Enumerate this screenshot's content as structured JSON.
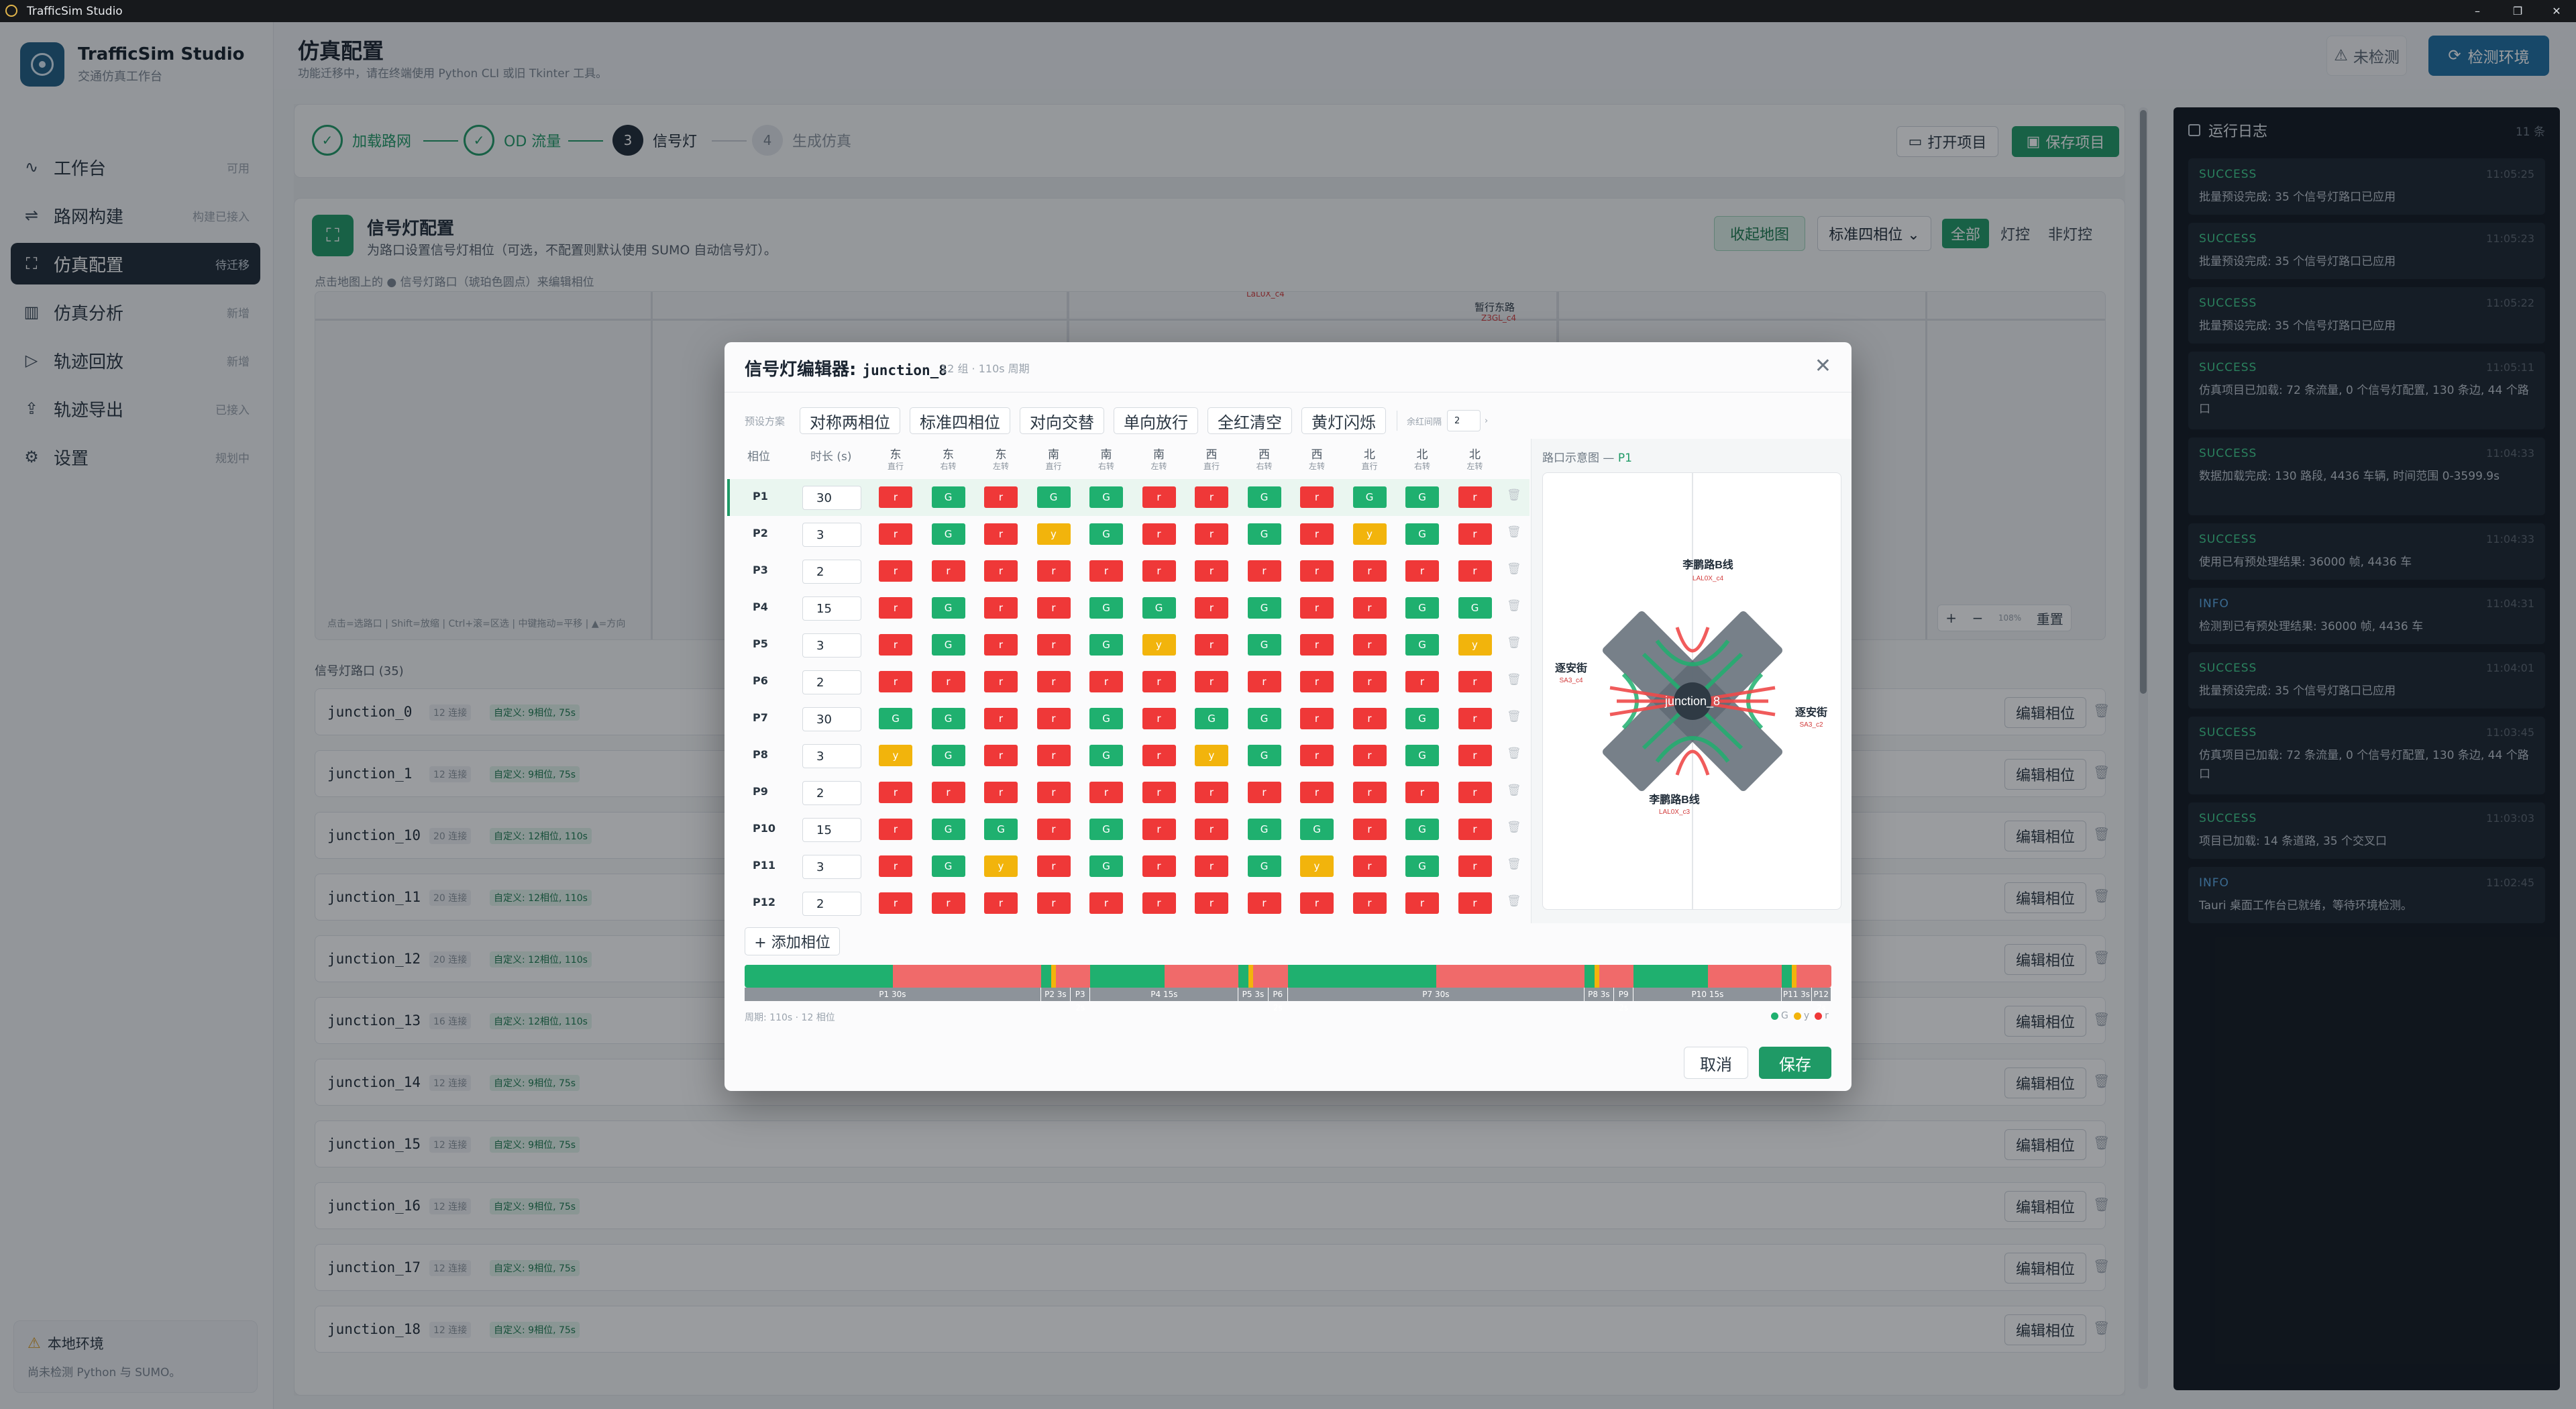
{
  "window": {
    "title": "TrafficSim Studio",
    "controls": [
      "–",
      "❐",
      "✕"
    ]
  },
  "sidebar": {
    "brand_name": "TrafficSim Studio",
    "brand_sub": "交通仿真工作台",
    "items": [
      {
        "label": "工作台",
        "badge": "可用",
        "icon": "activity-icon"
      },
      {
        "label": "路网构建",
        "badge": "构建已接入",
        "icon": "route-icon"
      },
      {
        "label": "仿真配置",
        "badge": "待迁移",
        "icon": "traffic-light-icon",
        "active": true
      },
      {
        "label": "仿真分析",
        "badge": "新增",
        "icon": "bar-chart-icon"
      },
      {
        "label": "轨迹回放",
        "badge": "新增",
        "icon": "play-icon"
      },
      {
        "label": "轨迹导出",
        "badge": "已接入",
        "icon": "upload-icon"
      },
      {
        "label": "设置",
        "badge": "规划中",
        "icon": "gear-icon"
      }
    ],
    "env_title": "本地环境",
    "env_sub": "尚未检测 Python 与 SUMO。"
  },
  "header": {
    "title": "仿真配置",
    "subtitle": "功能迁移中，请在终端使用 Python CLI 或旧 Tkinter 工具。",
    "unchecked_label": "未检测",
    "check_label": "检测环境"
  },
  "steps": {
    "items": [
      {
        "num": "✓",
        "label": "加载路网",
        "state": "done"
      },
      {
        "num": "✓",
        "label": "OD 流量",
        "state": "done"
      },
      {
        "num": "3",
        "label": "信号灯",
        "state": "cur"
      },
      {
        "num": "4",
        "label": "生成仿真",
        "state": "todo"
      }
    ],
    "open_label": "打开项目",
    "save_label": "保存项目"
  },
  "config": {
    "title": "信号灯配置",
    "subtitle": "为路口设置信号灯相位（可选，不配置则默认使用 SUMO 自动信号灯）。",
    "hint": "点击地图上的 ● 信号灯路口（琥珀色圆点）来编辑相位",
    "collapse_label": "收起地图",
    "preset_label": "标准四相位 ⌄",
    "seg_all": "全部",
    "seg_signal": "灯控",
    "seg_nonsignal": "非灯控",
    "map_labels": [
      "LaL0X_c4",
      "暂行东路",
      "Z3GL_c4"
    ],
    "map_tools": "点击=选路口 | Shift=放缩 | Ctrl+滚=区选 | 中键拖动=平移 | ▲=方向",
    "zoom": {
      "plus": "+",
      "minus": "−",
      "level": "108%",
      "reset": "重置"
    },
    "list_title": "信号灯路口 (35)",
    "edit_label": "编辑相位",
    "junctions": [
      {
        "name": "junction_0",
        "conns": "12 连接",
        "tag": "自定义: 9相位, 75s"
      },
      {
        "name": "junction_1",
        "conns": "12 连接",
        "tag": "自定义: 9相位, 75s"
      },
      {
        "name": "junction_10",
        "conns": "20 连接",
        "tag": "自定义: 12相位, 110s"
      },
      {
        "name": "junction_11",
        "conns": "20 连接",
        "tag": "自定义: 12相位, 110s"
      },
      {
        "name": "junction_12",
        "conns": "20 连接",
        "tag": "自定义: 12相位, 110s"
      },
      {
        "name": "junction_13",
        "conns": "16 连接",
        "tag": "自定义: 12相位, 110s"
      },
      {
        "name": "junction_14",
        "conns": "12 连接",
        "tag": "自定义: 9相位, 75s"
      },
      {
        "name": "junction_15",
        "conns": "12 连接",
        "tag": "自定义: 9相位, 75s"
      },
      {
        "name": "junction_16",
        "conns": "12 连接",
        "tag": "自定义: 9相位, 75s"
      },
      {
        "name": "junction_17",
        "conns": "12 连接",
        "tag": "自定义: 9相位, 75s"
      },
      {
        "name": "junction_18",
        "conns": "12 连接",
        "tag": "自定义: 9相位, 75s"
      }
    ]
  },
  "log": {
    "title": "运行日志",
    "count": "11 条",
    "entries": [
      {
        "type": "SUCCESS",
        "time": "11:05:25",
        "msg": "批量预设完成: 35 个信号灯路口已应用"
      },
      {
        "type": "SUCCESS",
        "time": "11:05:23",
        "msg": "批量预设完成: 35 个信号灯路口已应用"
      },
      {
        "type": "SUCCESS",
        "time": "11:05:22",
        "msg": "批量预设完成: 35 个信号灯路口已应用"
      },
      {
        "type": "SUCCESS",
        "time": "11:05:11",
        "msg": "仿真项目已加载: 72 条流量, 0 个信号灯配置, 130 条边, 44 个路口"
      },
      {
        "type": "SUCCESS",
        "time": "11:04:33",
        "msg": "数据加载完成: 130 路段, 4436 车辆, 时间范围 0-3599.9s"
      },
      {
        "type": "SUCCESS",
        "time": "11:04:33",
        "msg": "使用已有预处理结果: 36000 帧, 4436 车"
      },
      {
        "type": "INFO",
        "time": "11:04:31",
        "msg": "检测到已有预处理结果: 36000 帧, 4436 车"
      },
      {
        "type": "SUCCESS",
        "time": "11:04:01",
        "msg": "批量预设完成: 35 个信号灯路口已应用"
      },
      {
        "type": "SUCCESS",
        "time": "11:03:45",
        "msg": "仿真项目已加载: 72 条流量, 0 个信号灯配置, 130 条边, 44 个路口"
      },
      {
        "type": "SUCCESS",
        "time": "11:03:03",
        "msg": "项目已加载: 14 条道路, 35 个交叉口"
      },
      {
        "type": "INFO",
        "time": "11:02:45",
        "msg": "Tauri 桌面工作台已就绪，等待环境检测。"
      }
    ]
  },
  "modal": {
    "title_prefix": "信号灯编辑器:",
    "junction": "junction_8",
    "meta": "12 组 · 110s 周期",
    "close": "✕",
    "preset_label": "预设方案",
    "presets": [
      "对称两相位",
      "标准四相位",
      "对向交替",
      "单向放行",
      "全红清空",
      "黄灯闪烁"
    ],
    "yellow_label": "余红间隔",
    "yellow_value": "2",
    "col_phase": "相位",
    "col_duration": "时长 (s)",
    "directions": [
      {
        "dir": "东",
        "move": "直行"
      },
      {
        "dir": "东",
        "move": "右转"
      },
      {
        "dir": "东",
        "move": "左转"
      },
      {
        "dir": "南",
        "move": "直行"
      },
      {
        "dir": "南",
        "move": "右转"
      },
      {
        "dir": "南",
        "move": "左转"
      },
      {
        "dir": "西",
        "move": "直行"
      },
      {
        "dir": "西",
        "move": "右转"
      },
      {
        "dir": "西",
        "move": "左转"
      },
      {
        "dir": "北",
        "move": "直行"
      },
      {
        "dir": "北",
        "move": "右转"
      },
      {
        "dir": "北",
        "move": "左转"
      }
    ],
    "phases": [
      {
        "name": "P1",
        "duration": "30",
        "states": [
          "r",
          "G",
          "r",
          "G",
          "G",
          "r",
          "r",
          "G",
          "r",
          "G",
          "G",
          "r"
        ]
      },
      {
        "name": "P2",
        "duration": "3",
        "states": [
          "r",
          "G",
          "r",
          "y",
          "G",
          "r",
          "r",
          "G",
          "r",
          "y",
          "G",
          "r"
        ]
      },
      {
        "name": "P3",
        "duration": "2",
        "states": [
          "r",
          "r",
          "r",
          "r",
          "r",
          "r",
          "r",
          "r",
          "r",
          "r",
          "r",
          "r"
        ]
      },
      {
        "name": "P4",
        "duration": "15",
        "states": [
          "r",
          "G",
          "r",
          "r",
          "G",
          "G",
          "r",
          "G",
          "r",
          "r",
          "G",
          "G"
        ]
      },
      {
        "name": "P5",
        "duration": "3",
        "states": [
          "r",
          "G",
          "r",
          "r",
          "G",
          "y",
          "r",
          "G",
          "r",
          "r",
          "G",
          "y"
        ]
      },
      {
        "name": "P6",
        "duration": "2",
        "states": [
          "r",
          "r",
          "r",
          "r",
          "r",
          "r",
          "r",
          "r",
          "r",
          "r",
          "r",
          "r"
        ]
      },
      {
        "name": "P7",
        "duration": "30",
        "states": [
          "G",
          "G",
          "r",
          "r",
          "G",
          "r",
          "G",
          "G",
          "r",
          "r",
          "G",
          "r"
        ]
      },
      {
        "name": "P8",
        "duration": "3",
        "states": [
          "y",
          "G",
          "r",
          "r",
          "G",
          "r",
          "y",
          "G",
          "r",
          "r",
          "G",
          "r"
        ]
      },
      {
        "name": "P9",
        "duration": "2",
        "states": [
          "r",
          "r",
          "r",
          "r",
          "r",
          "r",
          "r",
          "r",
          "r",
          "r",
          "r",
          "r"
        ]
      },
      {
        "name": "P10",
        "duration": "15",
        "states": [
          "r",
          "G",
          "G",
          "r",
          "G",
          "r",
          "r",
          "G",
          "G",
          "r",
          "G",
          "r"
        ]
      },
      {
        "name": "P11",
        "duration": "3",
        "states": [
          "r",
          "G",
          "y",
          "r",
          "G",
          "r",
          "r",
          "G",
          "y",
          "r",
          "G",
          "r"
        ]
      },
      {
        "name": "P12",
        "duration": "2",
        "states": [
          "r",
          "r",
          "r",
          "r",
          "r",
          "r",
          "r",
          "r",
          "r",
          "r",
          "r",
          "r"
        ]
      }
    ],
    "diagram_title": "路口示意图 —",
    "diagram_phase": "P1",
    "diagram_center": "junction_8",
    "diagram_roads": [
      {
        "name": "李鹏路B线",
        "code": "LAL0X_c4"
      },
      {
        "name": "逐安街",
        "code": "SA3_c4"
      },
      {
        "name": "逐安街",
        "code": "SA3_c2"
      },
      {
        "name": "李鹏路B线",
        "code": "LAL0X_c3"
      }
    ],
    "add_phase": "+ 添加相位",
    "timeline_labels": [
      "P1 30s",
      "P2 3s",
      "P3 2s",
      "P4 15s",
      "P5 3s",
      "P6 2s",
      "P7 30s",
      "P8 3s",
      "P9 2s",
      "P10 15s",
      "P11 3s",
      "P12 2s"
    ],
    "cycle_text": "周期: 110s · 12 相位",
    "legend": [
      "G",
      "y",
      "r"
    ],
    "cancel": "取消",
    "save": "保存"
  }
}
